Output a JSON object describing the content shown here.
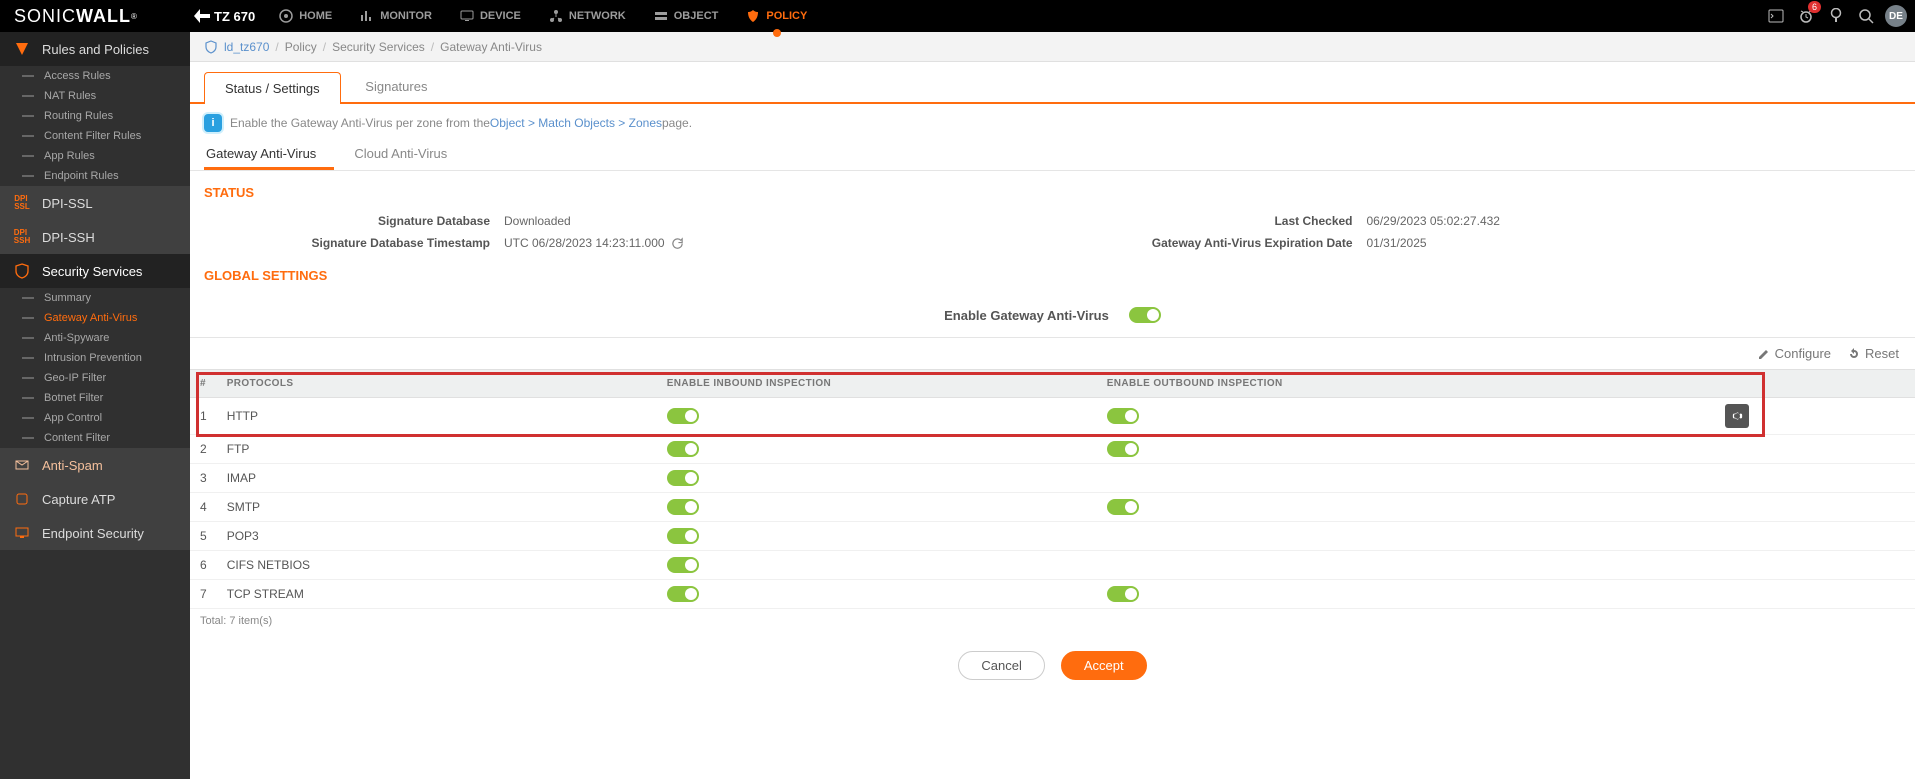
{
  "logo": {
    "a": "SONIC",
    "b": "WALL",
    "r": "®"
  },
  "device": "TZ 670",
  "nav": [
    {
      "id": "home",
      "label": "HOME"
    },
    {
      "id": "monitor",
      "label": "MONITOR"
    },
    {
      "id": "device",
      "label": "DEVICE"
    },
    {
      "id": "network",
      "label": "NETWORK"
    },
    {
      "id": "object",
      "label": "OBJECT"
    },
    {
      "id": "policy",
      "label": "POLICY"
    }
  ],
  "hdr": {
    "bell_badge": "6",
    "avatar": "DE"
  },
  "crumb": {
    "root": "ld_tz670",
    "a": "Policy",
    "b": "Security Services",
    "c": "Gateway Anti-Virus"
  },
  "sidebar": {
    "rules": {
      "title": "Rules and Policies",
      "items": [
        "Access Rules",
        "NAT Rules",
        "Routing Rules",
        "Content Filter Rules",
        "App Rules",
        "Endpoint Rules"
      ]
    },
    "dpi_ssl": "DPI-SSL",
    "dpi_ssl_ico": "DPI\nSSL",
    "dpi_ssh": "DPI-SSH",
    "dpi_ssh_ico": "DPI\nSSH",
    "security": {
      "title": "Security Services",
      "items": [
        "Summary",
        "Gateway Anti-Virus",
        "Anti-Spyware",
        "Intrusion Prevention",
        "Geo-IP Filter",
        "Botnet Filter",
        "App Control",
        "Content Filter"
      ]
    },
    "antispam": "Anti-Spam",
    "capture": "Capture ATP",
    "endpoint": "Endpoint Security"
  },
  "tabs_a": [
    "Status / Settings",
    "Signatures"
  ],
  "info": {
    "pre": "Enable the Gateway Anti-Virus per zone from the ",
    "link": "Object > Match Objects > Zones",
    "post": " page."
  },
  "tabs_b": [
    "Gateway Anti-Virus",
    "Cloud Anti-Virus"
  ],
  "sec_status": "STATUS",
  "status": {
    "sigdb_l": "Signature Database",
    "sigdb_v": "Downloaded",
    "sigts_l": "Signature Database Timestamp",
    "sigts_v": "UTC 06/28/2023 14:23:11.000",
    "last_l": "Last Checked",
    "last_v": "06/29/2023 05:02:27.432",
    "exp_l": "Gateway Anti-Virus Expiration Date",
    "exp_v": "01/31/2025"
  },
  "sec_global": "GLOBAL SETTINGS",
  "enable_label": "Enable Gateway Anti-Virus",
  "toolbar": {
    "configure": "Configure",
    "reset": "Reset"
  },
  "th": {
    "n": "#",
    "proto": "PROTOCOLS",
    "in": "ENABLE INBOUND INSPECTION",
    "out": "ENABLE OUTBOUND INSPECTION"
  },
  "rows": [
    {
      "n": "1",
      "p": "HTTP",
      "in": true,
      "out": true,
      "gear": true
    },
    {
      "n": "2",
      "p": "FTP",
      "in": true,
      "out": true
    },
    {
      "n": "3",
      "p": "IMAP",
      "in": true,
      "out": false
    },
    {
      "n": "4",
      "p": "SMTP",
      "in": true,
      "out": true
    },
    {
      "n": "5",
      "p": "POP3",
      "in": true,
      "out": false
    },
    {
      "n": "6",
      "p": "CIFS NETBIOS",
      "in": true,
      "out": false
    },
    {
      "n": "7",
      "p": "TCP STREAM",
      "in": true,
      "out": true
    }
  ],
  "total": "Total: 7 item(s)",
  "buttons": {
    "cancel": "Cancel",
    "accept": "Accept"
  }
}
